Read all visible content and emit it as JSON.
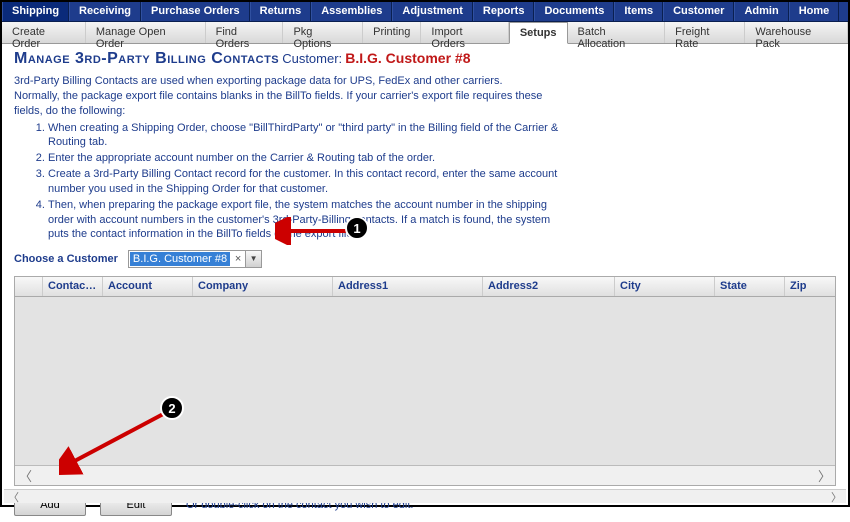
{
  "nav_primary": {
    "active_index": 0,
    "items": [
      "Shipping",
      "Receiving",
      "Purchase Orders",
      "Returns",
      "Assemblies",
      "Adjustment",
      "Reports",
      "Documents",
      "Items",
      "Customer",
      "Admin",
      "Home"
    ]
  },
  "nav_secondary": {
    "active_index": 6,
    "items": [
      "Create Order",
      "Manage Open Order",
      "Find Orders",
      "Pkg Options",
      "Printing",
      "Import Orders",
      "Setups",
      "Batch Allocation",
      "Freight Rate",
      "Warehouse Pack"
    ]
  },
  "page": {
    "title": "Manage 3rd-Party Billing Contacts",
    "customer_label": "Customer:",
    "customer_name": "B.I.G. Customer #8"
  },
  "help": {
    "intro1": "3rd-Party Billing Contacts are used when exporting package data for UPS, FedEx and other carriers.",
    "intro2": "Normally, the package export file contains blanks in the BillTo fields. If your carrier's export file requires these fields, do the following:",
    "steps": [
      "When creating a Shipping Order, choose \"BillThirdParty\" or \"third party\" in the Billing field of the Carrier & Routing tab.",
      "Enter the appropriate account number on the Carrier & Routing tab of the order.",
      "Create a 3rd-Party Billing Contact record for the customer. In this contact record, enter the same account number you used in the Shipping Order for that customer.",
      "Then, when preparing the package export file, the system matches the account number in the shipping order with account numbers in the customer's 3rd-Party-Billing contacts. If a match is found, the system puts the contact information in the BillTo fields of the export file."
    ]
  },
  "chooser": {
    "label": "Choose a Customer",
    "value": "B.I.G. Customer #8"
  },
  "grid": {
    "columns": [
      "",
      "Contact...",
      "Account",
      "Company",
      "Address1",
      "Address2",
      "City",
      "State",
      "Zip"
    ],
    "rows": []
  },
  "footer": {
    "add": "Add",
    "edit": "Edit",
    "hint": "Or double-click on the contact you wish to edit."
  },
  "annotations": {
    "a1": "1",
    "a2": "2"
  }
}
